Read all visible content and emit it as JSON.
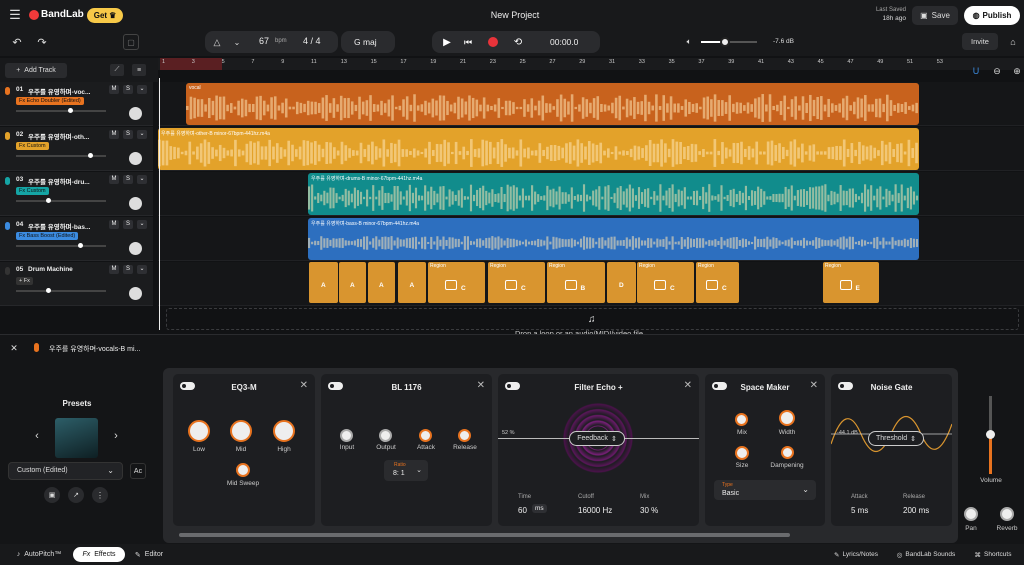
{
  "app": {
    "name": "BandLab",
    "get_label": "Get",
    "project_title": "New Project",
    "last_saved_label": "Last Saved",
    "last_saved_time": "18h ago",
    "save_label": "Save",
    "publish_label": "Publish",
    "invite_label": "Invite"
  },
  "transport": {
    "bpm": "67",
    "bpm_unit": "bpm",
    "time_sig": "4 / 4",
    "key": "G maj",
    "time": "00:00.0",
    "volume_db": "-7.6 dB"
  },
  "add_track_label": "Add Track",
  "ruler": [
    "1",
    "3",
    "5",
    "7",
    "9",
    "11",
    "13",
    "15",
    "17",
    "19",
    "21",
    "23",
    "25",
    "27",
    "29",
    "31",
    "33",
    "35",
    "37",
    "39",
    "41",
    "43",
    "45",
    "47",
    "49",
    "51",
    "53"
  ],
  "tracks": [
    {
      "num": "01",
      "name": "우주를 유영하며-voc...",
      "fx": "Fx Echo Doubler (Edited)",
      "fx_color": "#e8731f",
      "clip_label": "vocal",
      "clip_color": "#c8621d"
    },
    {
      "num": "02",
      "name": "우주를 유영하며-oth...",
      "fx": "Fx Custom",
      "fx_color": "#e3a22a",
      "clip_label": "우주를 유영하며-other-B minor-67bpm-441hz.m4a",
      "clip_color": "#e3a22a"
    },
    {
      "num": "03",
      "name": "우주를 유영하며-dru...",
      "fx": "Fx Custom",
      "fx_color": "#15a5a5",
      "clip_label": "우주를 유영하며-drums-B minor-67bpm-441hz.m4a",
      "clip_color": "#118c8c"
    },
    {
      "num": "04",
      "name": "우주를 유영하며-bas...",
      "fx": "Fx Bass Boost (Edited)",
      "fx_color": "#3b8be0",
      "clip_label": "우주를 유영하며-bass-B minor-67bpm-441hz.m4a",
      "clip_color": "#2d6fbf"
    },
    {
      "num": "05",
      "name": "Drum Machine",
      "fx": "+ Fx",
      "fx_color": "#333",
      "clip_label": "",
      "clip_color": "#d9952f"
    }
  ],
  "regions": [
    {
      "title": "",
      "letter": "A"
    },
    {
      "title": "",
      "letter": "A"
    },
    {
      "title": "",
      "letter": "A"
    },
    {
      "title": "",
      "letter": "A"
    },
    {
      "title": "Region",
      "letter": "C"
    },
    {
      "title": "Region",
      "letter": "C"
    },
    {
      "title": "Region",
      "letter": "B"
    },
    {
      "title": "",
      "letter": "D"
    },
    {
      "title": "Region",
      "letter": "C"
    },
    {
      "title": "Region",
      "letter": "C"
    },
    {
      "title": "Region",
      "letter": "E"
    }
  ],
  "drop_hint": "Drop a loop or an audio/MIDI/video file",
  "editor": {
    "track_name": "우주를 유영하며-vocals-B mi...",
    "presets_label": "Presets",
    "preset_value": "Custom (Edited)"
  },
  "plugins": {
    "eq": {
      "title": "EQ3-M",
      "low": "Low",
      "mid": "Mid",
      "high": "High",
      "mid_sweep": "Mid Sweep"
    },
    "bl": {
      "title": "BL 1176",
      "input": "Input",
      "output": "Output",
      "attack": "Attack",
      "release": "Release",
      "ratio_label": "Ratio",
      "ratio": "8: 1"
    },
    "echo": {
      "title": "Filter Echo +",
      "mode": "Feedback",
      "pct": "52 %",
      "time_label": "Time",
      "time": "60",
      "time_unit": "ms",
      "cutoff_label": "Cutoff",
      "cutoff": "16000 Hz",
      "mix_label": "Mix",
      "mix": "30 %"
    },
    "space": {
      "title": "Space Maker",
      "mix": "Mix",
      "width": "Width",
      "size": "Size",
      "dampening": "Dampening",
      "type_label": "Type",
      "type": "Basic"
    },
    "gate": {
      "title": "Noise Gate",
      "db": "-44.1 dB",
      "mode": "Threshold",
      "attack_label": "Attack",
      "attack": "5 ms",
      "release_label": "Release",
      "release": "200 ms"
    }
  },
  "master": {
    "volume_label": "Volume",
    "pan_label": "Pan",
    "reverb_label": "Reverb"
  },
  "bottom": {
    "autopitch": "AutoPitch™",
    "effects": "Effects",
    "editor": "Editor",
    "lyrics": "Lyrics/Notes",
    "sounds": "BandLab Sounds",
    "shortcuts": "Shortcuts"
  }
}
